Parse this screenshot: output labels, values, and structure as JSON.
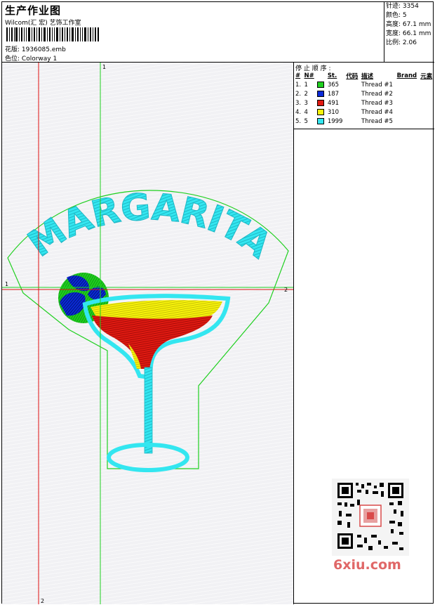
{
  "header": {
    "title": "生产作业图",
    "studio": "Wilcom(汇 宏) 艺饰工作室",
    "design_label": "花版:",
    "design_file": "1936085.emb",
    "colorway_label": "色位:",
    "colorway": "Colorway 1"
  },
  "specs": [
    {
      "label": "针迹:",
      "value": "3354"
    },
    {
      "label": "颜色:",
      "value": "5"
    },
    {
      "label": "高度:",
      "value": "67.1 mm"
    },
    {
      "label": "宽度:",
      "value": "66.1 mm"
    },
    {
      "label": "比例:",
      "value": "2.06"
    }
  ],
  "stop_sequence": {
    "title": "停 止 顺 序 :",
    "columns": [
      "#",
      "N#",
      "St.",
      "代码",
      "描述",
      "Brand",
      "元素"
    ],
    "rows": [
      {
        "num": "1.",
        "n": "1",
        "color": "#1fd01f",
        "stitches": "365",
        "desc": "Thread #1"
      },
      {
        "num": "2.",
        "n": "2",
        "color": "#0a2ad8",
        "stitches": "187",
        "desc": "Thread #2"
      },
      {
        "num": "3.",
        "n": "3",
        "color": "#e01a12",
        "stitches": "491",
        "desc": "Thread #3"
      },
      {
        "num": "4.",
        "n": "4",
        "color": "#f6f20a",
        "stitches": "310",
        "desc": "Thread #4"
      },
      {
        "num": "5.",
        "n": "5",
        "color": "#33e6f0",
        "stitches": "1999",
        "desc": "Thread #5"
      }
    ]
  },
  "design": {
    "text": "MARGARITA",
    "guide_labels": {
      "v1": "1",
      "h1": "1",
      "h2": "2",
      "v2": "2"
    }
  },
  "colors": {
    "green": "#1fd01f",
    "blue": "#0a2ad8",
    "red": "#e01a12",
    "yellow": "#f6f20a",
    "cyan": "#33e6f0",
    "guide_red": "#e01010",
    "guide_green": "#1fd01f"
  },
  "watermark": "6xiu.com"
}
